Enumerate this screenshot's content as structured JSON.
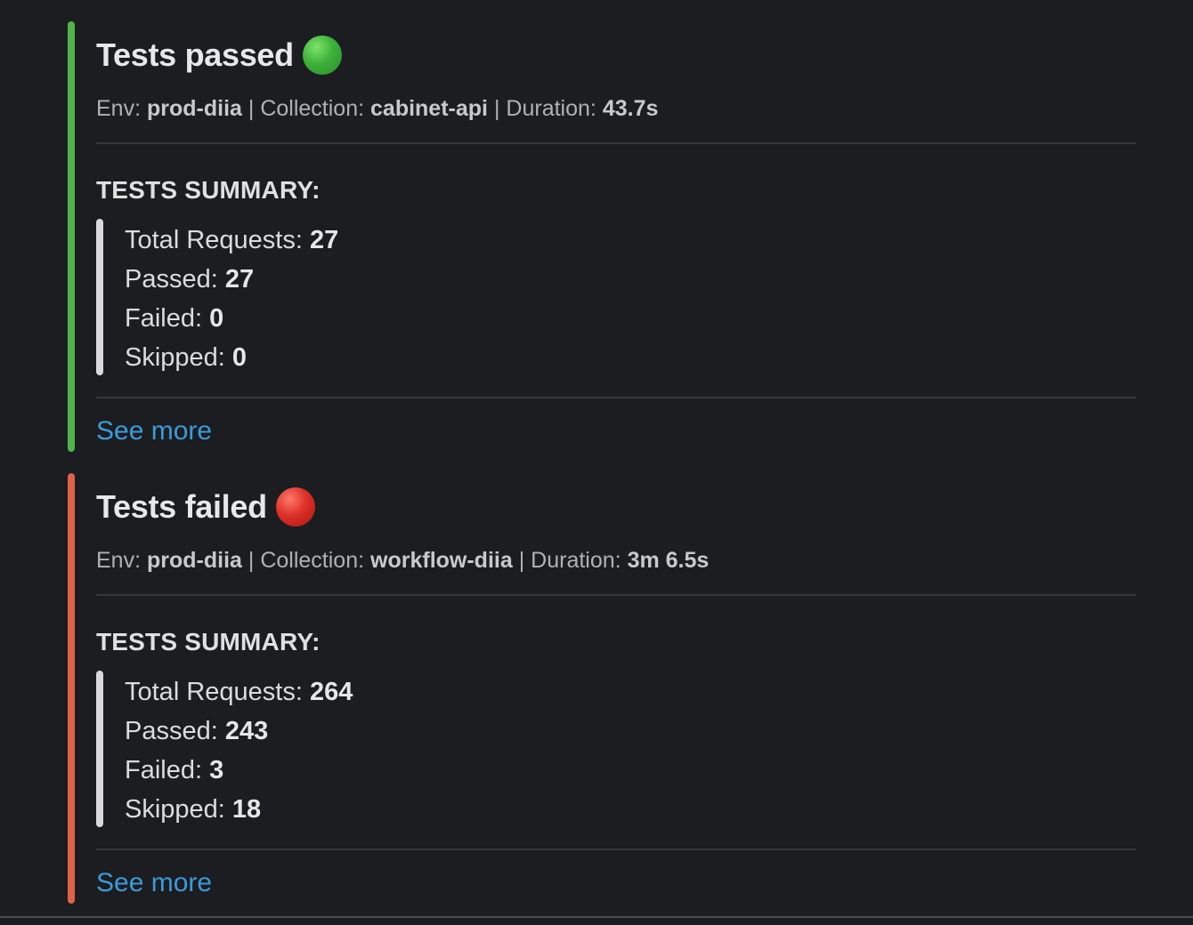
{
  "cards": [
    {
      "title": "Tests passed",
      "status_icon": "green-circle-icon",
      "accent_color": "#4fb54a",
      "meta": {
        "env_label": "Env:",
        "env_value": "prod-diia",
        "separator": "|",
        "collection_label": "Collection:",
        "collection_value": "cabinet-api",
        "duration_label": "Duration:",
        "duration_value": "43.7s"
      },
      "summary_heading": "TESTS SUMMARY:",
      "summary": {
        "total_label": "Total Requests:",
        "total_value": "27",
        "passed_label": "Passed:",
        "passed_value": "27",
        "failed_label": "Failed:",
        "failed_value": "0",
        "skipped_label": "Skipped:",
        "skipped_value": "0"
      },
      "see_more": "See more"
    },
    {
      "title": "Tests failed",
      "status_icon": "red-circle-icon",
      "accent_color": "#e0614b",
      "meta": {
        "env_label": "Env:",
        "env_value": "prod-diia",
        "separator": "|",
        "collection_label": "Collection:",
        "collection_value": "workflow-diia",
        "duration_label": "Duration:",
        "duration_value": "3m 6.5s"
      },
      "summary_heading": "TESTS SUMMARY:",
      "summary": {
        "total_label": "Total Requests:",
        "total_value": "264",
        "passed_label": "Passed:",
        "passed_value": "243",
        "failed_label": "Failed:",
        "failed_value": "3",
        "skipped_label": "Skipped:",
        "skipped_value": "18"
      },
      "see_more": "See more"
    }
  ]
}
